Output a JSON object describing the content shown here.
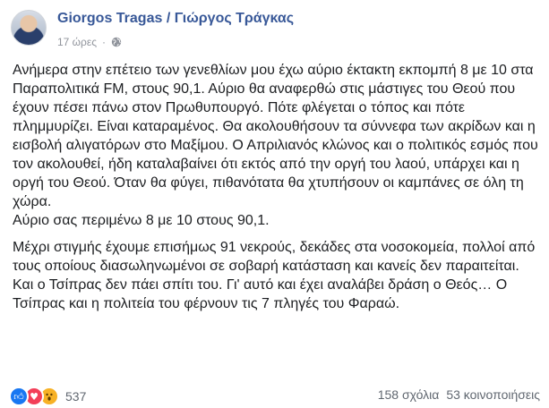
{
  "post": {
    "author": "Giorgos Tragas / Γιώργος Τράγκας",
    "timestamp": "17 ώρες",
    "separator": "·",
    "privacy_icon": "globe-icon",
    "paragraph_1": "Ανήμερα στην επέτειο των γενεθλίων μου έχω αύριο έκτακτη εκπομπή 8 με 10 στα Παραπολιτικά FM, στους 90,1. Αύριο θα αναφερθώ στις μάστιγες του Θεού που έχουν πέσει πάνω στον Πρωθυπουργό. Πότε φλέγεται ο τόπος και πότε πλημμυρίζει. Είναι καταραμένος. Θα ακολουθήσουν τα σύννεφα των ακρίδων και η εισβολή αλιγατόρων στο Μαξίμου. Ο Απριλιανός κλώνος και ο πολιτικός εσμός που τον ακολουθεί, ήδη καταλαβαίνει ότι εκτός από την οργή του λαού, υπάρχει και η οργή του Θεού. Όταν θα φύγει, πιθανότατα θα χτυπήσουν οι καμπάνες σε όλη τη χώρα.",
    "paragraph_1b": "Αύριο σας περιμένω 8 με 10 στους 90,1.",
    "paragraph_2": "Μέχρι στιγμής έχουμε επισήμως 91 νεκρούς, δεκάδες στα νοσοκομεία, πολλοί από τους οποίους διασωληνωμένοι σε σοβαρή κατάσταση και κανείς δεν παραιτείται. Και ο Τσίπρας δεν πάει σπίτι του. Γι' αυτό και έχει αναλάβει δράση ο Θεός… Ο Τσίπρας και η πολιτεία του φέρνουν τις 7 πληγές του Φαραώ."
  },
  "footer": {
    "reaction_icons": [
      "like-icon",
      "love-icon",
      "wow-icon"
    ],
    "reaction_count": "537",
    "comments": "158 σχόλια",
    "shares": "53 κοινοποιήσεις"
  },
  "colors": {
    "author": "#385898",
    "meta": "#90949c",
    "like": "#1877f2",
    "love": "#f33e58",
    "wow": "#f7b125"
  }
}
